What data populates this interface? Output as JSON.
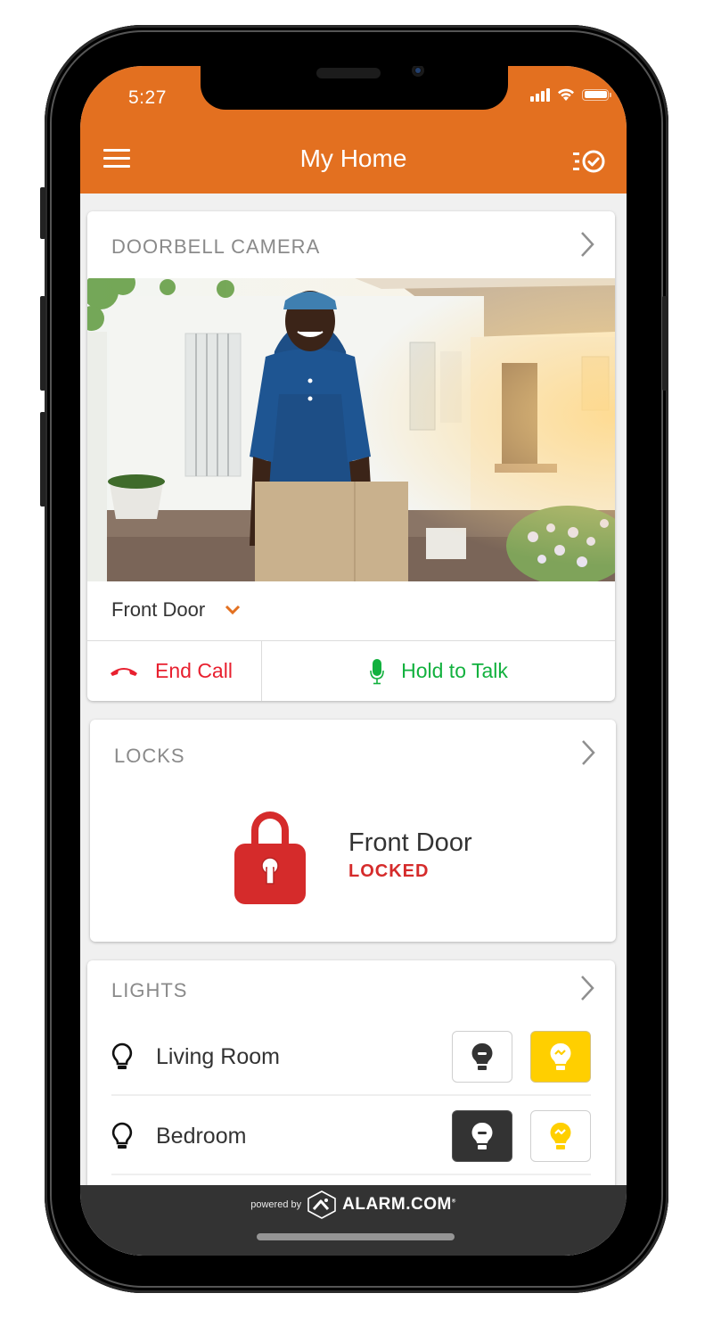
{
  "status_bar": {
    "time": "5:27",
    "icons": [
      "signal-icon",
      "wifi-icon",
      "battery-icon"
    ]
  },
  "header": {
    "title": "My Home",
    "menu_icon": "hamburger-menu-icon",
    "tasks_icon": "task-list-check-icon"
  },
  "colors": {
    "brand_orange": "#e37020",
    "end_call_red": "#e8202f",
    "talk_green": "#12b13e",
    "locked_red": "#d52b2b",
    "light_on_yellow": "#ffcf00",
    "light_off_dark": "#333333",
    "footer_bg": "#333333"
  },
  "doorbell": {
    "section_title": "DOORBELL CAMERA",
    "camera_name": "Front Door",
    "end_call_label": "End Call",
    "talk_label": "Hold to Talk"
  },
  "locks": {
    "section_title": "LOCKS",
    "device_name": "Front Door",
    "status": "LOCKED"
  },
  "lights": {
    "section_title": "LIGHTS",
    "items": [
      {
        "name": "Living Room",
        "state": "on"
      },
      {
        "name": "Bedroom",
        "state": "off"
      }
    ]
  },
  "footer": {
    "powered_by": "powered by",
    "brand": "ALARM.COM",
    "trademark": "®"
  }
}
